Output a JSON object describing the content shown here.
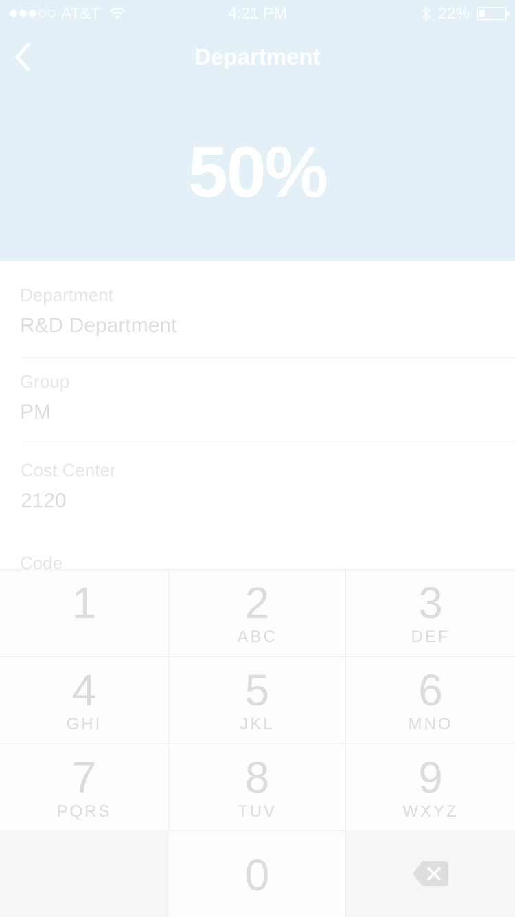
{
  "status_bar": {
    "carrier": "AT&T",
    "time": "4:21 PM",
    "battery_percent": "22%",
    "battery_level": 0.22
  },
  "nav": {
    "title": "Department"
  },
  "percent": "50%",
  "form": {
    "fields": [
      {
        "label": "Department",
        "value": "R&D Department"
      },
      {
        "label": "Group",
        "value": "PM"
      },
      {
        "label": "Cost Center",
        "value": "2120"
      },
      {
        "label": "Code",
        "value": ""
      }
    ]
  },
  "keypad": {
    "keys": [
      {
        "digit": "1",
        "letters": ""
      },
      {
        "digit": "2",
        "letters": "ABC"
      },
      {
        "digit": "3",
        "letters": "DEF"
      },
      {
        "digit": "4",
        "letters": "GHI"
      },
      {
        "digit": "5",
        "letters": "JKL"
      },
      {
        "digit": "6",
        "letters": "MNO"
      },
      {
        "digit": "7",
        "letters": "PQRS"
      },
      {
        "digit": "8",
        "letters": "TUV"
      },
      {
        "digit": "9",
        "letters": "WXYZ"
      },
      {
        "digit": "0",
        "letters": ""
      }
    ],
    "delete_icon": "delete-backspace-icon"
  },
  "colors": {
    "header_bg": "#e3f0f8",
    "text_faded": "#dcdcdc"
  }
}
